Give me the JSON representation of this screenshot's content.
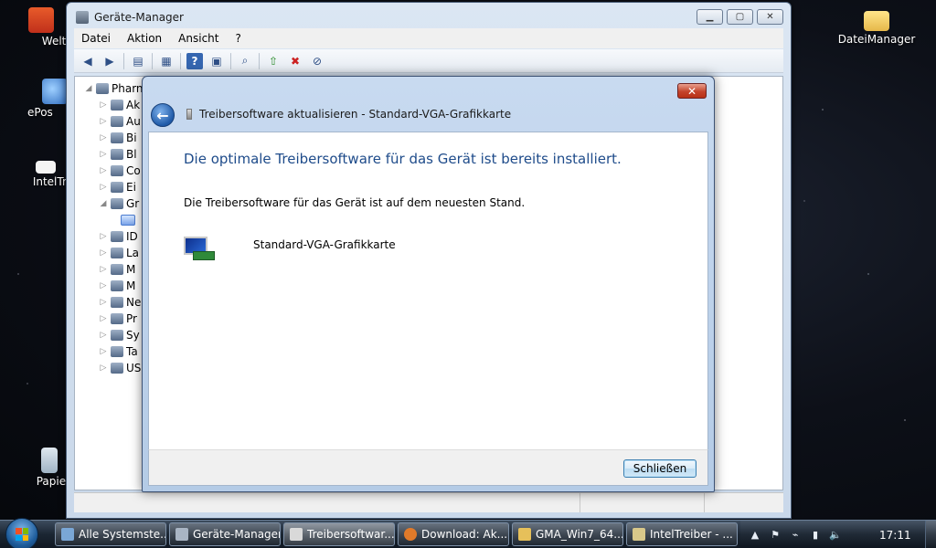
{
  "desktop": {
    "icons": [
      {
        "label": "Weltn"
      },
      {
        "label": "ePos"
      },
      {
        "label": "IntelTre"
      },
      {
        "label": "Papierk"
      },
      {
        "label": "DateiManager"
      }
    ]
  },
  "device_manager": {
    "title": "Geräte-Manager",
    "menu": [
      "Datei",
      "Aktion",
      "Ansicht",
      "?"
    ],
    "tree": {
      "root": "Pharn",
      "items": [
        "Ak",
        "Au",
        "Bi",
        "Bl",
        "Co",
        "Ei",
        "Gr",
        "",
        "ID",
        "La",
        "M",
        "M",
        "Ne",
        "Pr",
        "Sy",
        "Ta",
        "US"
      ]
    }
  },
  "dialog": {
    "title": "Treibersoftware aktualisieren - Standard-VGA-Grafikkarte",
    "heading": "Die optimale Treibersoftware für das Gerät ist bereits installiert.",
    "message": "Die Treibersoftware für das Gerät ist auf dem neuesten Stand.",
    "device_name": "Standard-VGA-Grafikkarte",
    "close_button": "Schließen",
    "close_x": "✕"
  },
  "taskbar": {
    "tasks": [
      {
        "label": "Alle Systemste...",
        "color": "#7aa7d6"
      },
      {
        "label": "Geräte-Manager",
        "color": "#a9b5c4"
      },
      {
        "label": "Treibersoftwar...",
        "color": "#d9d9d9"
      },
      {
        "label": "Download: Ak...",
        "color": "#e07a2a"
      },
      {
        "label": "GMA_Win7_64...",
        "color": "#e6c05a"
      },
      {
        "label": "IntelTreiber - ...",
        "color": "#d8c88a"
      }
    ],
    "clock": "17:11"
  }
}
